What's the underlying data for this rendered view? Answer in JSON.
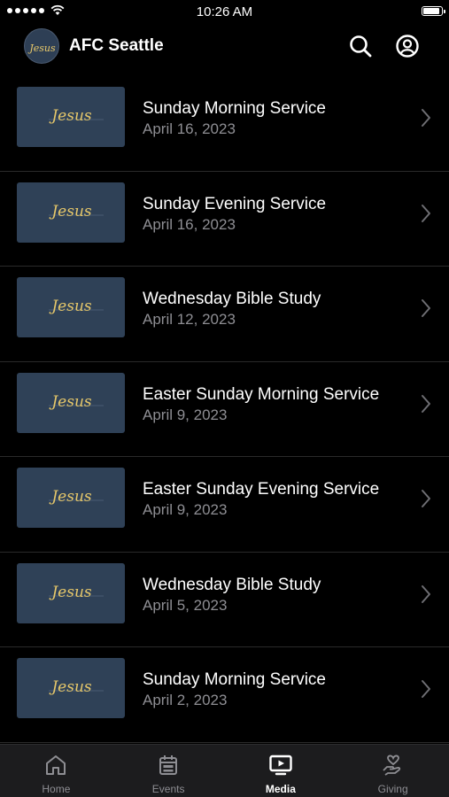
{
  "status_bar": {
    "time": "10:26 AM",
    "battery_level": 0.95
  },
  "header": {
    "title": "AFC Seattle",
    "logo_text": "Jesus"
  },
  "thumbnail_text": "Jesus",
  "colors": {
    "background": "#000000",
    "thumbnail": "#2f4157",
    "script_gold": "#e7c86a",
    "secondary_text": "#8e8e93",
    "tab_bar": "#1c1c1e"
  },
  "media_items": [
    {
      "title": "Sunday Morning Service",
      "date": "April 16, 2023"
    },
    {
      "title": "Sunday Evening Service",
      "date": "April 16, 2023"
    },
    {
      "title": "Wednesday Bible Study",
      "date": "April 12, 2023"
    },
    {
      "title": "Easter Sunday Morning Service",
      "date": "April 9, 2023"
    },
    {
      "title": "Easter Sunday Evening Service",
      "date": "April 9, 2023"
    },
    {
      "title": "Wednesday Bible Study",
      "date": "April 5, 2023"
    },
    {
      "title": "Sunday Morning Service",
      "date": "April 2, 2023"
    }
  ],
  "tabs": [
    {
      "label": "Home",
      "icon": "home-icon",
      "active": false
    },
    {
      "label": "Events",
      "icon": "calendar-icon",
      "active": false
    },
    {
      "label": "Media",
      "icon": "media-icon",
      "active": true
    },
    {
      "label": "Giving",
      "icon": "giving-icon",
      "active": false
    }
  ]
}
